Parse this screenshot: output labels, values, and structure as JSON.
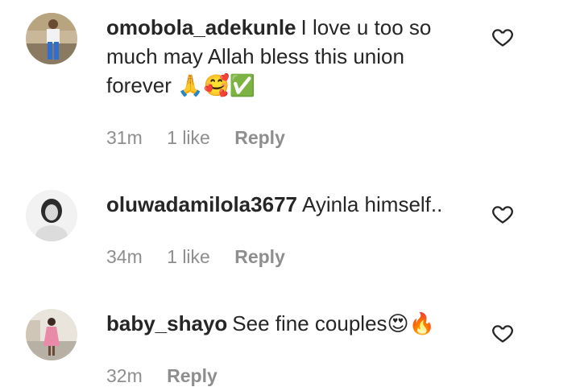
{
  "comments": [
    {
      "username": "omobola_adekunle",
      "text": "I love u too so much may Allah bless this union forever",
      "emojis": "🙏🥰✅",
      "time": "31m",
      "likes": "1 like",
      "reply": "Reply"
    },
    {
      "username": "oluwadamilola3677",
      "text": "Ayinla himself..",
      "emojis": "",
      "time": "34m",
      "likes": "1 like",
      "reply": "Reply"
    },
    {
      "username": "baby_shayo",
      "text": "See fine couples",
      "emojis": "😍🔥",
      "time": "32m",
      "likes": "",
      "reply": "Reply"
    }
  ],
  "icons": {
    "like": "heart-outline-icon"
  }
}
